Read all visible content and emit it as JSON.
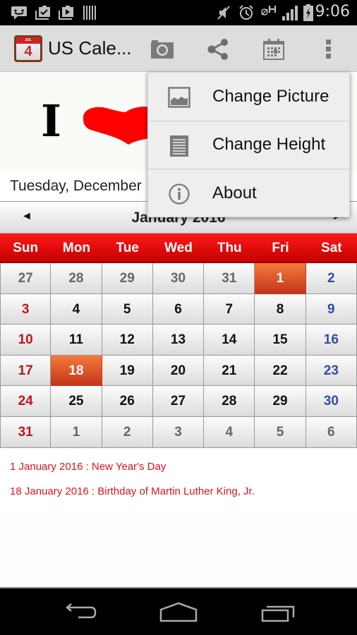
{
  "status_bar": {
    "left_icons": [
      "messaging-icon",
      "task-check-icon",
      "media-play-icon",
      "barcode-icon"
    ],
    "right_icons": [
      "mute-icon",
      "alarm-icon",
      "h-signal-icon",
      "cell-signal-icon",
      "battery-charging-icon"
    ],
    "time": "9:06"
  },
  "action_bar": {
    "app_icon": {
      "month_label": "JUL",
      "day": "4"
    },
    "title": "US Cale...",
    "actions": [
      "camera-icon",
      "share-icon",
      "calendar-icon",
      "overflow-menu-icon"
    ]
  },
  "banner": {
    "text_i": "I",
    "heart_color": "#ff0000"
  },
  "date_line": "Tuesday, December",
  "calendar": {
    "prev_label": "◄",
    "next_label": "►",
    "month_title": "January  2016",
    "weekdays": [
      "Sun",
      "Mon",
      "Tue",
      "Wed",
      "Thu",
      "Fri",
      "Sat"
    ],
    "weeks": [
      [
        {
          "d": "27",
          "t": "other"
        },
        {
          "d": "28",
          "t": "other"
        },
        {
          "d": "29",
          "t": "other"
        },
        {
          "d": "30",
          "t": "other"
        },
        {
          "d": "31",
          "t": "other"
        },
        {
          "d": "1",
          "t": "holiday"
        },
        {
          "d": "2",
          "t": "sat"
        }
      ],
      [
        {
          "d": "3",
          "t": "sun"
        },
        {
          "d": "4",
          "t": ""
        },
        {
          "d": "5",
          "t": ""
        },
        {
          "d": "6",
          "t": ""
        },
        {
          "d": "7",
          "t": ""
        },
        {
          "d": "8",
          "t": ""
        },
        {
          "d": "9",
          "t": "sat"
        }
      ],
      [
        {
          "d": "10",
          "t": "sun"
        },
        {
          "d": "11",
          "t": ""
        },
        {
          "d": "12",
          "t": ""
        },
        {
          "d": "13",
          "t": ""
        },
        {
          "d": "14",
          "t": ""
        },
        {
          "d": "15",
          "t": ""
        },
        {
          "d": "16",
          "t": "sat"
        }
      ],
      [
        {
          "d": "17",
          "t": "sun"
        },
        {
          "d": "18",
          "t": "holiday"
        },
        {
          "d": "19",
          "t": ""
        },
        {
          "d": "20",
          "t": ""
        },
        {
          "d": "21",
          "t": ""
        },
        {
          "d": "22",
          "t": ""
        },
        {
          "d": "23",
          "t": "sat"
        }
      ],
      [
        {
          "d": "24",
          "t": "sun"
        },
        {
          "d": "25",
          "t": ""
        },
        {
          "d": "26",
          "t": ""
        },
        {
          "d": "27",
          "t": ""
        },
        {
          "d": "28",
          "t": ""
        },
        {
          "d": "29",
          "t": ""
        },
        {
          "d": "30",
          "t": "sat"
        }
      ],
      [
        {
          "d": "31",
          "t": "sun"
        },
        {
          "d": "1",
          "t": "other"
        },
        {
          "d": "2",
          "t": "other"
        },
        {
          "d": "3",
          "t": "other"
        },
        {
          "d": "4",
          "t": "other"
        },
        {
          "d": "5",
          "t": "other"
        },
        {
          "d": "6",
          "t": "other"
        }
      ]
    ],
    "colors": {
      "header_red": "#e00000",
      "sunday": "#c0141b",
      "saturday": "#2f4fa0",
      "holiday_cell": "#e0582c"
    }
  },
  "holidays": [
    "1 January 2016 : New Year's Day",
    "18 January 2016 : Birthday of Martin Luther King, Jr."
  ],
  "overflow_menu": {
    "items": [
      {
        "label": "Change Picture",
        "icon": "picture-icon"
      },
      {
        "label": "Change Height",
        "icon": "height-list-icon"
      },
      {
        "label": "About",
        "icon": "info-icon"
      }
    ]
  },
  "nav_bar": {
    "buttons": [
      "back-icon",
      "home-icon",
      "recents-icon"
    ]
  }
}
